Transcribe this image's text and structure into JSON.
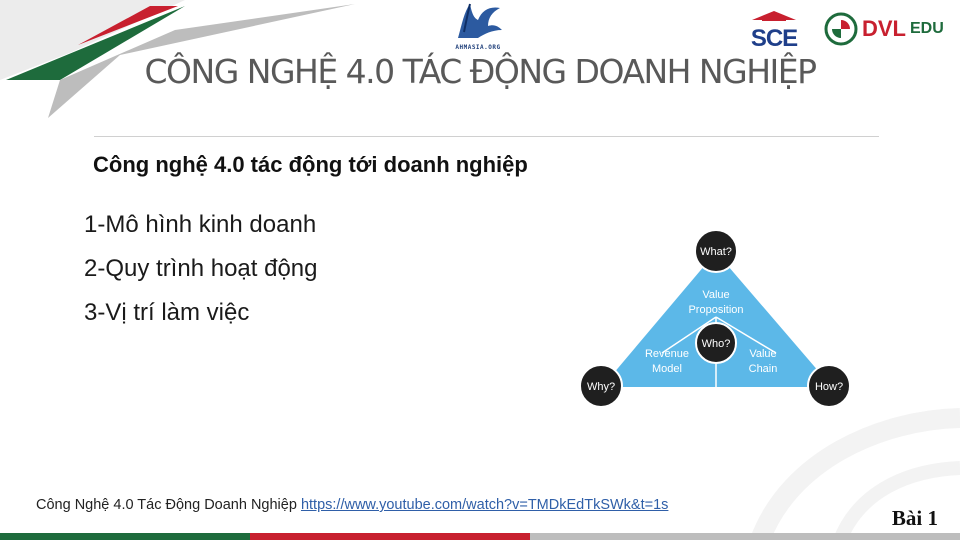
{
  "slide": {
    "title": "CÔNG NGHỆ 4.0 TÁC ĐỘNG DOANH NGHIỆP",
    "subtitle": "Công nghệ 4.0 tác động tới doanh nghiệp",
    "bullets": [
      "1-Mô hình kinh doanh",
      "2-Quy trình hoạt động",
      "3-Vị trí làm việc"
    ],
    "footer_text": "Công Nghệ 4.0 Tác Động Doanh Nghiệp",
    "footer_link": "https://www.youtube.com/watch?v=TMDkEdTkSWk&t=1s",
    "lesson_label": "Bài 1"
  },
  "logos": {
    "center_caption": "AHMASIA.ORG",
    "sce": "SCE",
    "dvl_main": "DVL",
    "dvl_sub": "EDU"
  },
  "diagram": {
    "nodes": {
      "top": "What?",
      "center": "Who?",
      "left": "Why?",
      "right": "How?"
    },
    "regions": {
      "top_line1": "Value",
      "top_line2": "Proposition",
      "left_line1": "Revenue",
      "left_line2": "Model",
      "right_line1": "Value",
      "right_line2": "Chain"
    }
  },
  "colors": {
    "green": "#1e6b3c",
    "red": "#c8202f",
    "grey": "#bdbdbd",
    "triangle": "#5cb8e8",
    "node": "#1f1f1f",
    "title": "#595959"
  }
}
